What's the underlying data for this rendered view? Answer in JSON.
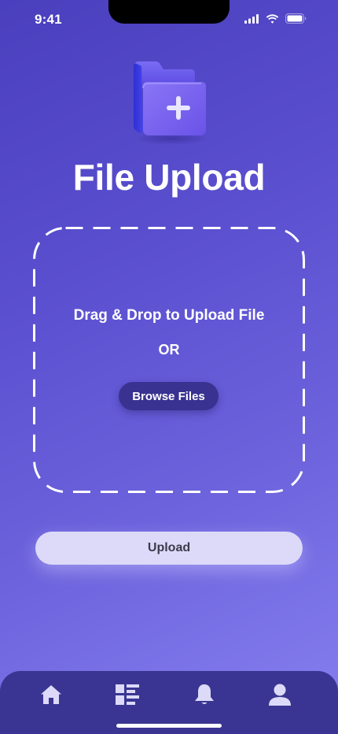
{
  "status_bar": {
    "time": "9:41"
  },
  "page": {
    "title": "File Upload"
  },
  "dropzone": {
    "instruction": "Drag & Drop to Upload File",
    "separator": "OR",
    "browse_label": "Browse Files"
  },
  "upload": {
    "label": "Upload"
  },
  "bottom_nav": {
    "items": [
      {
        "icon": "home-icon"
      },
      {
        "icon": "list-icon"
      },
      {
        "icon": "bell-icon"
      },
      {
        "icon": "user-icon"
      }
    ]
  },
  "colors": {
    "background_top": "#4a3fbd",
    "background_bottom": "#8680f0",
    "browse_button": "#3a3290",
    "upload_button": "#dcdaf8",
    "nav_bar": "#3a3592",
    "nav_icon": "#dcdaf8"
  }
}
